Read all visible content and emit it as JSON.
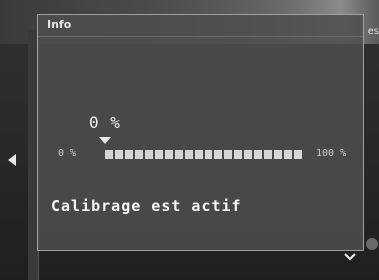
{
  "dialog": {
    "title": "Info"
  },
  "calibration": {
    "value_label": "0 %",
    "scale_min": "0 %",
    "scale_max": "100 %",
    "progress": 0,
    "segments": 20,
    "status": "Calibrage est actif"
  },
  "colors": {
    "dialog_bg": "#4e4e4e",
    "dialog_border": "#a0a0a0",
    "segment": "#d6d6d6",
    "text": "#f2f2f2"
  }
}
